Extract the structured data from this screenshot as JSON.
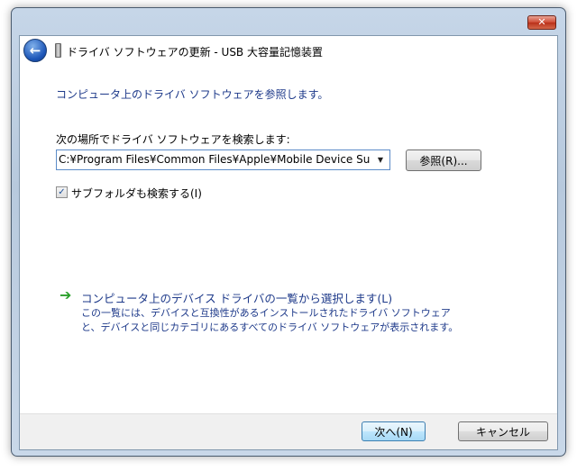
{
  "window": {
    "title": "ドライバ ソフトウェアの更新 - USB 大容量記憶装置",
    "close_glyph": "✕"
  },
  "header": {
    "back_glyph": "←"
  },
  "main": {
    "heading": "コンピュータ上のドライバ ソフトウェアを参照します。",
    "search_label": "次の場所でドライバ ソフトウェアを検索します:",
    "path_value": "C:¥Program Files¥Common Files¥Apple¥Mobile Device Suppo",
    "combo_arrow": "▼",
    "browse_label": "参照(R)...",
    "include_subfolders_label": "サブフォルダも検索する(I)",
    "include_subfolders_checked": true,
    "checkbox_glyph": "✓",
    "pick_link": {
      "arrow": "➔",
      "title": "コンピュータ上のデバイス ドライバの一覧から選択します(L)",
      "description_line1": "この一覧には、デバイスと互換性があるインストールされたドライバ ソフトウェア",
      "description_line2": "と、デバイスと同じカテゴリにあるすべてのドライバ ソフトウェアが表示されます。"
    }
  },
  "footer": {
    "next_label": "次へ(N)",
    "cancel_label": "キャンセル"
  },
  "colors": {
    "link_blue": "#1e3a8a",
    "arrow_green": "#2ba02b"
  },
  "icons": [
    "back-arrow-icon",
    "usb-drive-icon",
    "close-icon",
    "chevron-down-icon",
    "checkmark-icon",
    "green-arrow-icon"
  ]
}
